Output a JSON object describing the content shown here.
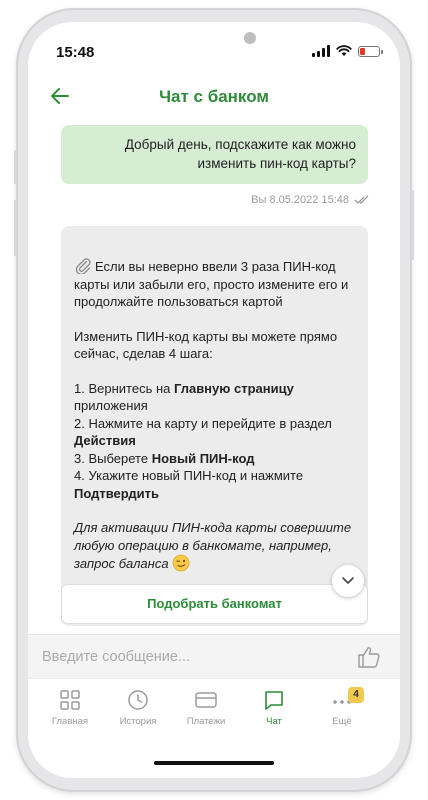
{
  "status_bar": {
    "time": "15:48"
  },
  "header": {
    "title": "Чат с банком"
  },
  "chat": {
    "user_message": {
      "text": "Добрый день, подскажите как можно изменить пин-код карты?",
      "meta": "Вы 8.05.2022 15:48"
    },
    "bank_message": {
      "intro": "Если вы неверно ввели 3 раза ПИН-код карты или забыли его, просто измените его и продолжайте пользоваться картой",
      "steps_intro": "Изменить ПИН-код карты вы можете прямо сейчас, сделав 4 шага:",
      "step1_prefix": "1. Вернитесь на ",
      "step1_bold": "Главную страницу",
      "step1_suffix": " приложения",
      "step2_prefix": "2. Нажмите на карту и перейдите в раздел ",
      "step2_bold": "Действия",
      "step3_prefix": "3. Выберете ",
      "step3_bold": "Новый ПИН-код",
      "step4_prefix": "4. Укажите новый ПИН-код и нажмите ",
      "step4_bold": "Подтвердить",
      "note": "Для активации ПИН-кода карты совершите любую операцию в банкомате, например, запрос баланса"
    },
    "atm_button_label": "Подобрать банкомат"
  },
  "input": {
    "placeholder": "Введите сообщение..."
  },
  "bottom_nav": {
    "items": [
      {
        "label": "Главная",
        "icon": "grid-icon"
      },
      {
        "label": "История",
        "icon": "clock-icon"
      },
      {
        "label": "Платежи",
        "icon": "card-icon"
      },
      {
        "label": "Чат",
        "icon": "chat-icon"
      },
      {
        "label": "Ещё",
        "icon": "more-icon",
        "badge": "4"
      }
    ]
  },
  "colors": {
    "accent": "#2e8b3a",
    "user_bubble": "#d6edd4",
    "bank_bubble": "#ececec",
    "badge": "#f2c94c"
  }
}
